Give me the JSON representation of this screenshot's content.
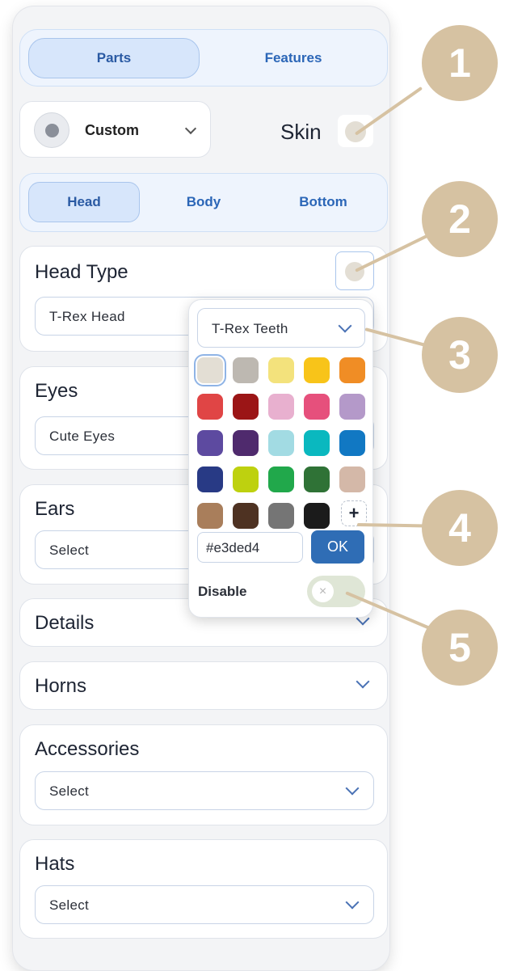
{
  "top_tabs": [
    {
      "label": "Parts",
      "active": true
    },
    {
      "label": "Features",
      "active": false
    }
  ],
  "skin": {
    "preset_label": "Custom",
    "label": "Skin",
    "color": "#e3ded4"
  },
  "part_tabs": [
    {
      "label": "Head",
      "active": true
    },
    {
      "label": "Body",
      "active": false
    },
    {
      "label": "Bottom",
      "active": false
    }
  ],
  "sections": {
    "head_type": {
      "title": "Head Type",
      "value": "T-Rex Head"
    },
    "eyes": {
      "title": "Eyes",
      "value": "Cute Eyes"
    },
    "ears": {
      "title": "Ears",
      "value": "Select"
    },
    "details": {
      "title": "Details"
    },
    "horns": {
      "title": "Horns"
    },
    "accessories": {
      "title": "Accessories",
      "value": "Select"
    },
    "hats": {
      "title": "Hats",
      "value": "Select"
    }
  },
  "color_picker": {
    "target": "T-Rex Teeth",
    "swatches": [
      "#e3ded4",
      "#bdb8b1",
      "#f3e27c",
      "#f8c419",
      "#f08d25",
      "#e04545",
      "#9b1516",
      "#e8b0cf",
      "#e6507c",
      "#b499c9",
      "#5d4aa0",
      "#4f2a6d",
      "#a2dbe3",
      "#0ab8bf",
      "#1178c3",
      "#283a85",
      "#bed10f",
      "#21a84b",
      "#2f7236",
      "#d4b8a8",
      "#a97e5b",
      "#4e3222",
      "#757575",
      "#1b1b1b"
    ],
    "selected": "#e3ded4",
    "add_label": "+",
    "hex_value": "#e3ded4",
    "ok_label": "OK",
    "disable_label": "Disable",
    "disable_toggle_icon": "×",
    "disabled": false
  },
  "callouts": [
    "1",
    "2",
    "3",
    "4",
    "5"
  ],
  "colors": {
    "accent": "#2f6db5",
    "callout": "#d6c2a2",
    "ok_button": "#2f6db5"
  }
}
